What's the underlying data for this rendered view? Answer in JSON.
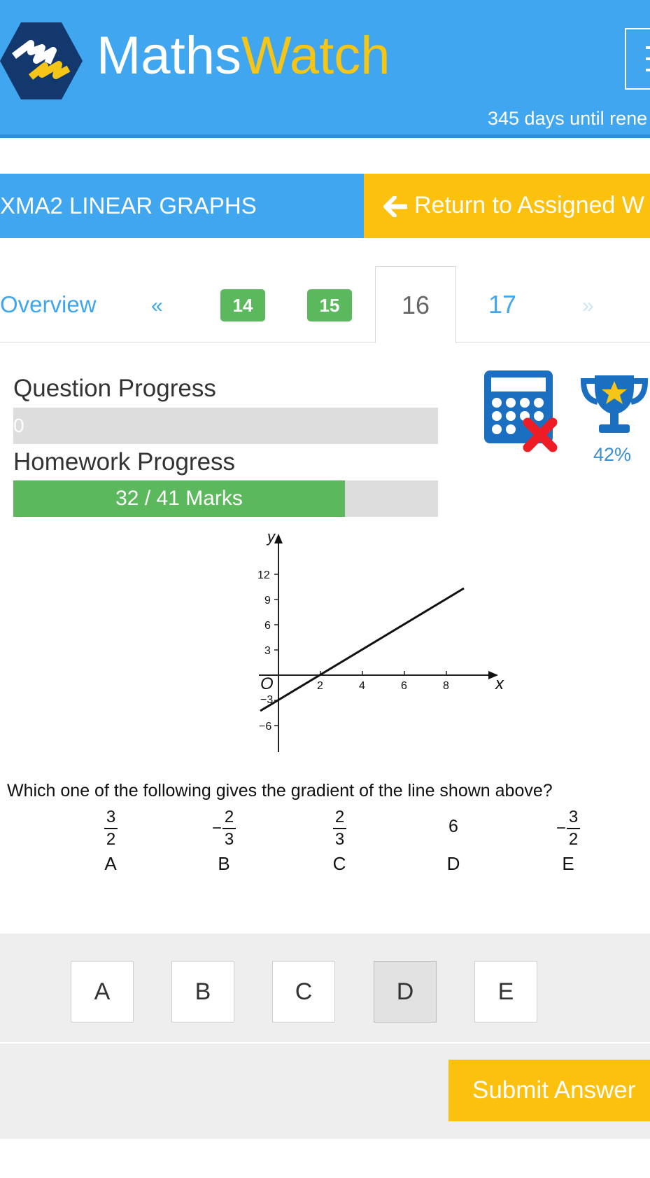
{
  "header": {
    "brand_part1": "Maths",
    "brand_part2": "Watch",
    "renewal_text": "345 days until rene"
  },
  "assignment": {
    "title": "XMA2 LINEAR GRAPHS",
    "return_label": "Return to Assigned W"
  },
  "tabs": {
    "overview": "Overview",
    "prev": "«",
    "q14": "14",
    "q15": "15",
    "q16": "16",
    "q17": "17",
    "next": "»"
  },
  "progress": {
    "question_label": "Question Progress",
    "question_value": "0",
    "homework_label": "Homework Progress",
    "homework_text": "32 / 41 Marks",
    "homework_marks": 32,
    "homework_total": 41
  },
  "score": {
    "percent": "42%"
  },
  "graph": {
    "y_label": "y",
    "x_label": "x",
    "origin": "O",
    "y_ticks": [
      "12",
      "9",
      "6",
      "3",
      "−3",
      "−6"
    ],
    "x_ticks": [
      "2",
      "4",
      "6",
      "8"
    ]
  },
  "question": {
    "text": "Which one of the following gives the gradient of the line shown above?",
    "options": [
      {
        "letter": "A",
        "sign": "",
        "num": "3",
        "den": "2"
      },
      {
        "letter": "B",
        "sign": "−",
        "num": "2",
        "den": "3"
      },
      {
        "letter": "C",
        "sign": "",
        "num": "2",
        "den": "3"
      },
      {
        "letter": "D",
        "value": "6"
      },
      {
        "letter": "E",
        "sign": "−",
        "num": "3",
        "den": "2"
      }
    ]
  },
  "answers": {
    "a": "A",
    "b": "B",
    "c": "C",
    "d": "D",
    "e": "E",
    "selected": "D"
  },
  "submit_label": "Submit Answer",
  "colors": {
    "header_blue": "#3fa6ef",
    "accent_yellow": "#fbc10e",
    "progress_green": "#5cb85c",
    "error_red": "#ee1c24"
  }
}
